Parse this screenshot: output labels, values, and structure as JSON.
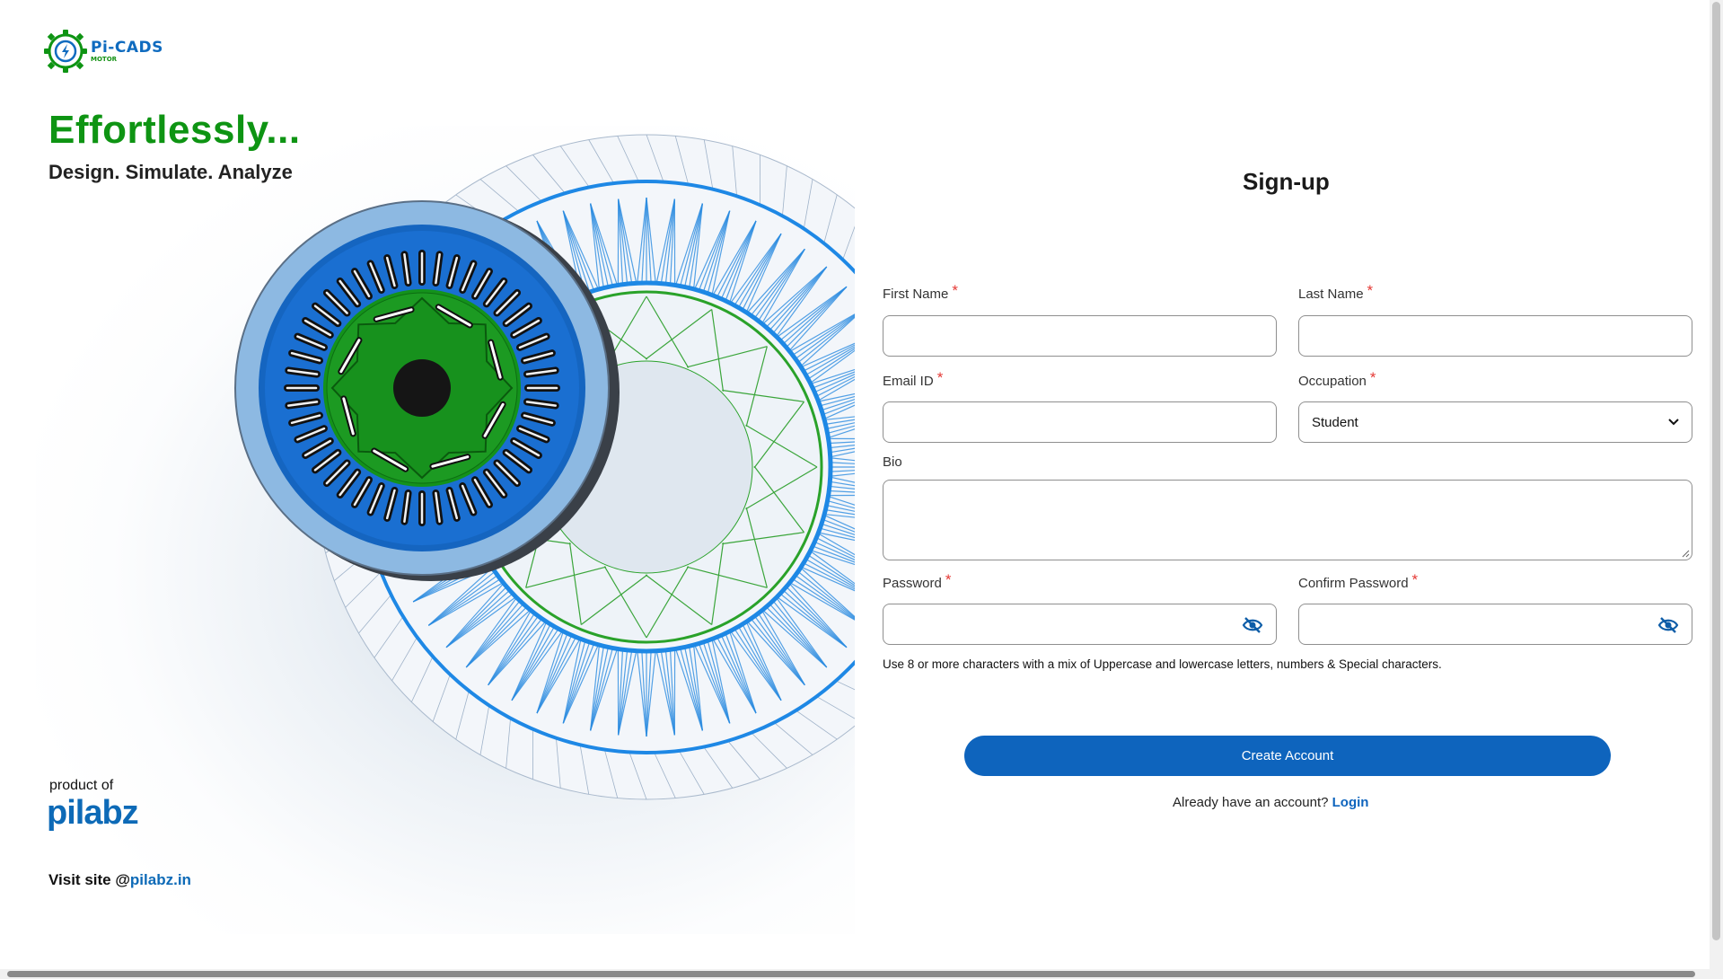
{
  "brand": {
    "app_name": "Pi-CADS",
    "app_sub": "MOTOR",
    "headline": "Effortlessly...",
    "tagline": "Design. Simulate. Analyze",
    "product_of": "product of",
    "company": "pilabz",
    "visit_prefix": "Visit site @",
    "visit_link": "pilabz.in"
  },
  "form": {
    "title": "Sign-up",
    "first_name_label": "First Name",
    "last_name_label": "Last Name",
    "email_label": "Email ID",
    "occupation_label": "Occupation",
    "occupation_value": "Student",
    "bio_label": "Bio",
    "password_label": "Password",
    "confirm_password_label": "Confirm Password",
    "required_mark": "*",
    "password_hint": "Use 8 or more characters with a mix of Uppercase and lowercase letters, numbers & Special characters.",
    "submit_label": "Create Account",
    "login_prompt": "Already have an account?",
    "login_link": "Login"
  },
  "colors": {
    "accent_blue": "#0e64bd",
    "brand_green": "#0e9413",
    "required_red": "#e53935"
  }
}
